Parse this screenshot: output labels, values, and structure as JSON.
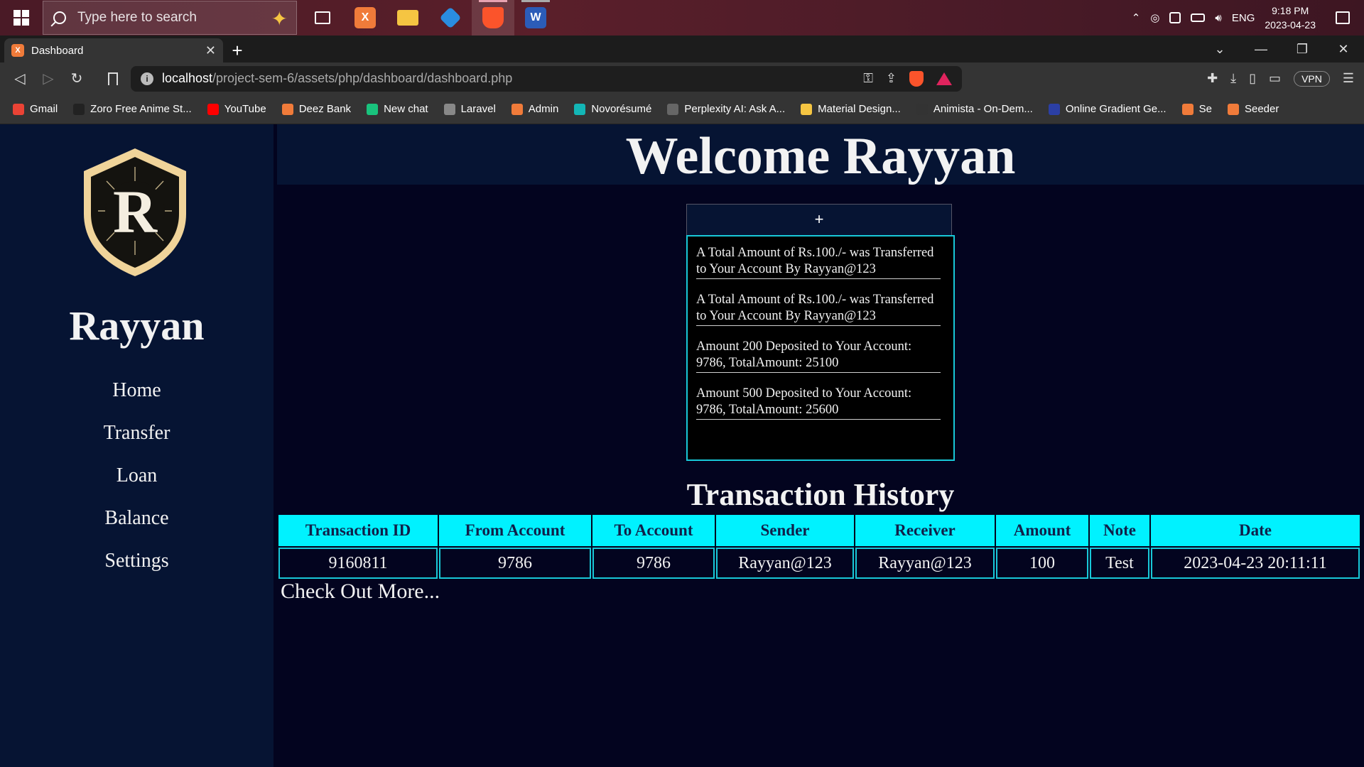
{
  "taskbar": {
    "search_placeholder": "Type here to search",
    "apps": [
      {
        "name": "task-view",
        "label": ""
      },
      {
        "name": "xampp",
        "label": "X"
      },
      {
        "name": "file-explorer",
        "label": ""
      },
      {
        "name": "vscode",
        "label": ""
      },
      {
        "name": "brave",
        "label": ""
      },
      {
        "name": "word",
        "label": "W"
      }
    ],
    "language": "ENG",
    "time": "9:18 PM",
    "date": "2023-04-23"
  },
  "browser": {
    "tab_title": "Dashboard",
    "url_host": "localhost",
    "url_path": "/project-sem-6/assets/php/dashboard/dashboard.php",
    "vpn_label": "VPN",
    "bookmarks": [
      {
        "label": "Gmail",
        "color": "#ea4335"
      },
      {
        "label": "Zoro Free Anime St...",
        "color": "#222222"
      },
      {
        "label": "YouTube",
        "color": "#ff0000"
      },
      {
        "label": "Deez Bank",
        "color": "#f07b3a"
      },
      {
        "label": "New chat",
        "color": "#19c37d"
      },
      {
        "label": "Laravel",
        "color": "#888888"
      },
      {
        "label": "Admin",
        "color": "#f07b3a"
      },
      {
        "label": "Novorésumé",
        "color": "#13b6b6"
      },
      {
        "label": "Perplexity AI: Ask A...",
        "color": "#666666"
      },
      {
        "label": "Material Design...",
        "color": "#f5c542"
      },
      {
        "label": "Animista - On-Dem...",
        "color": "#333333"
      },
      {
        "label": "Online Gradient Ge...",
        "color": "#2b3fa5"
      },
      {
        "label": "Se",
        "color": "#f07b3a"
      },
      {
        "label": "Seeder",
        "color": "#f07b3a"
      }
    ]
  },
  "sidebar": {
    "logo_letter": "R",
    "brand": "Rayyan",
    "nav": [
      "Home",
      "Transfer",
      "Loan",
      "Balance",
      "Settings"
    ]
  },
  "header": {
    "welcome": "Welcome Rayyan"
  },
  "notifications": {
    "toggle_label": "+",
    "items": [
      "A Total Amount of Rs.100./- was Transferred to Your Account By Rayyan@123",
      "A Total Amount of Rs.100./- was Transferred to Your Account By Rayyan@123",
      "Amount 200 Deposited to Your Account: 9786, TotalAmount: 25100",
      "Amount 500 Deposited to Your Account: 9786, TotalAmount: 25600"
    ]
  },
  "history": {
    "title": "Transaction History",
    "columns": [
      "Transaction ID",
      "From Account",
      "To Account",
      "Sender",
      "Receiver",
      "Amount",
      "Note",
      "Date"
    ],
    "rows": [
      [
        "9160811",
        "9786",
        "9786",
        "Rayyan@123",
        "Rayyan@123",
        "100",
        "Test",
        "2023-04-23 20:11:11"
      ]
    ],
    "more_link": "Check Out More..."
  },
  "colors": {
    "accent": "#00f2ff",
    "sidebar_bg": "#061433",
    "page_bg": "#03041f",
    "logo_gold": "#f0d49a"
  }
}
